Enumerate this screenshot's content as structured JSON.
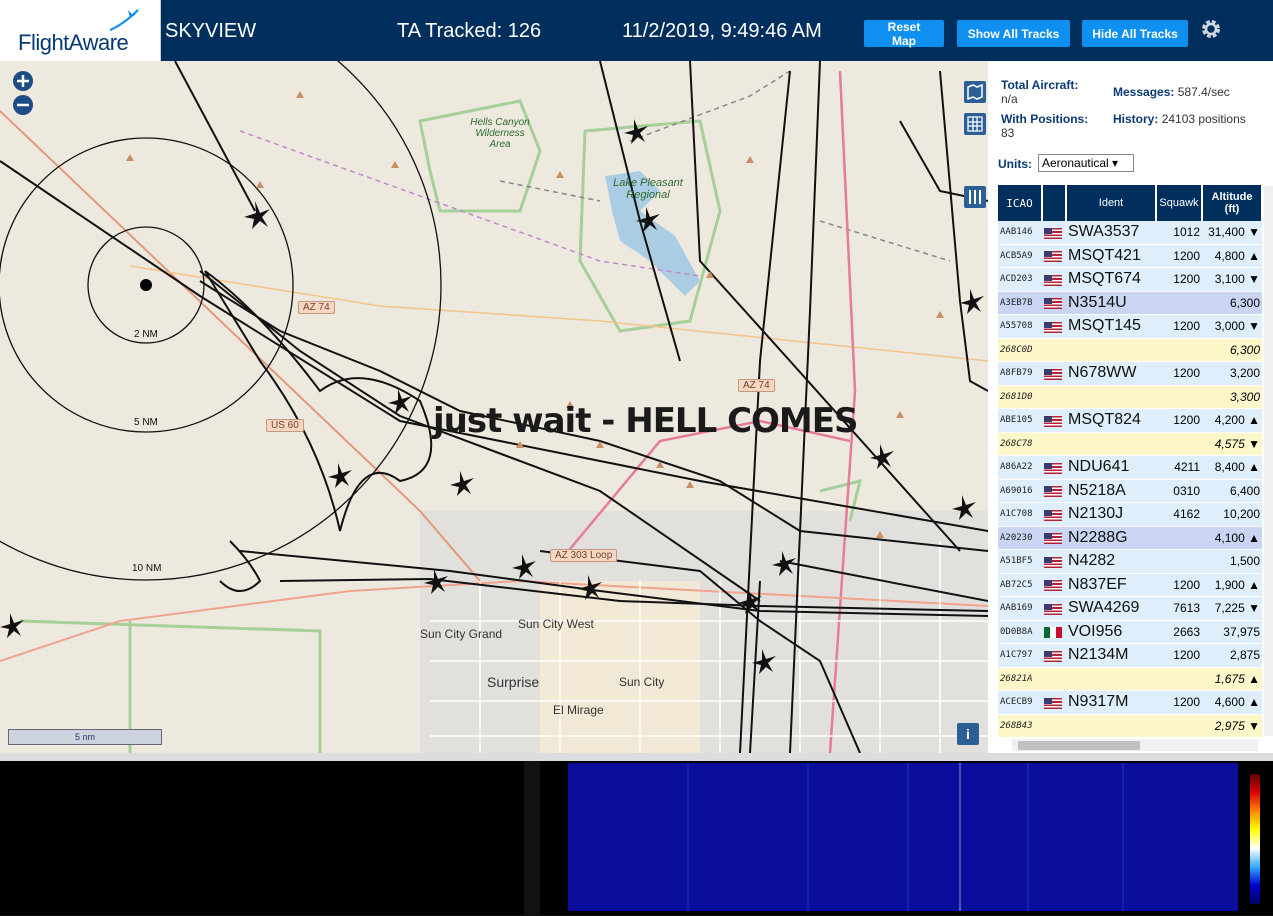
{
  "header": {
    "logo": "FlightAware",
    "site_name": "SKYVIEW",
    "ta_tracked": "TA Tracked: 126",
    "clock": "11/2/2019, 9:49:46 AM",
    "buttons": {
      "reset": "Reset Map",
      "show": "Show All Tracks",
      "hide": "Hide All Tracks"
    }
  },
  "map": {
    "overlay_text": "just wait - HELL COMES",
    "places": [
      "Hells Canyon Wilderness Area",
      "Lake Pleasant Regional",
      "Sun City Grand",
      "Sun City West",
      "Surprise",
      "Sun City",
      "El Mirage"
    ],
    "range_rings": [
      "2 NM",
      "5 NM",
      "10 NM"
    ],
    "road_tags": [
      "AZ 74",
      "AZ 74",
      "US 60",
      "AZ 303 Loop"
    ],
    "scale": "5 nm",
    "info": "i"
  },
  "sidebar": {
    "total_label": "Total Aircraft:",
    "total_value": "n/a",
    "messages_label": "Messages:",
    "messages_value": "587.4/sec",
    "positions_label": "With Positions:",
    "positions_value": "83",
    "history_label": "History:",
    "history_value": "24103 positions",
    "units_label": "Units:",
    "units_value": "Aeronautical",
    "columns": [
      "ICAO",
      "",
      "Ident",
      "Squawk",
      "Altitude (ft)"
    ],
    "rows": [
      {
        "icao": "AAB146",
        "flag": "us",
        "ident": "SWA3537",
        "squawk": "1012",
        "alt": "31,400 ▼",
        "style": "blue"
      },
      {
        "icao": "ACB5A9",
        "flag": "us",
        "ident": "MSQT421",
        "squawk": "1200",
        "alt": "4,800 ▲",
        "style": "blue"
      },
      {
        "icao": "ACD203",
        "flag": "us",
        "ident": "MSQT674",
        "squawk": "1200",
        "alt": "3,100 ▼",
        "style": "blue"
      },
      {
        "icao": "A3EB7B",
        "flag": "us",
        "ident": "N3514U",
        "squawk": "",
        "alt": "6,300",
        "style": "sel"
      },
      {
        "icao": "A55708",
        "flag": "us",
        "ident": "MSQT145",
        "squawk": "1200",
        "alt": "3,000 ▼",
        "style": "blue"
      },
      {
        "icao": "268C0D",
        "flag": "",
        "ident": "",
        "squawk": "",
        "alt": "6,300",
        "style": "yellow"
      },
      {
        "icao": "A8FB79",
        "flag": "us",
        "ident": "N678WW",
        "squawk": "1200",
        "alt": "3,200",
        "style": "blue"
      },
      {
        "icao": "2681D0",
        "flag": "",
        "ident": "",
        "squawk": "",
        "alt": "3,300",
        "style": "yellow"
      },
      {
        "icao": "ABE105",
        "flag": "us",
        "ident": "MSQT824",
        "squawk": "1200",
        "alt": "4,200 ▲",
        "style": "blue"
      },
      {
        "icao": "268C78",
        "flag": "",
        "ident": "",
        "squawk": "",
        "alt": "4,575 ▼",
        "style": "yellow"
      },
      {
        "icao": "A86A22",
        "flag": "us",
        "ident": "NDU641",
        "squawk": "4211",
        "alt": "8,400 ▲",
        "style": "blue"
      },
      {
        "icao": "A69016",
        "flag": "us",
        "ident": "N5218A",
        "squawk": "0310",
        "alt": "6,400",
        "style": "blue"
      },
      {
        "icao": "A1C708",
        "flag": "us",
        "ident": "N2130J",
        "squawk": "4162",
        "alt": "10,200",
        "style": "blue"
      },
      {
        "icao": "A20230",
        "flag": "us",
        "ident": "N2288G",
        "squawk": "",
        "alt": "4,100 ▲",
        "style": "sel"
      },
      {
        "icao": "A51BF5",
        "flag": "us",
        "ident": "N4282",
        "squawk": "",
        "alt": "1,500",
        "style": "blue"
      },
      {
        "icao": "AB72C5",
        "flag": "us",
        "ident": "N837EF",
        "squawk": "1200",
        "alt": "1,900 ▲",
        "style": "blue"
      },
      {
        "icao": "AAB169",
        "flag": "us",
        "ident": "SWA4269",
        "squawk": "7613",
        "alt": "7,225 ▼",
        "style": "blue"
      },
      {
        "icao": "0D0B8A",
        "flag": "mx",
        "ident": "VOI956",
        "squawk": "2663",
        "alt": "37,975",
        "style": "blue"
      },
      {
        "icao": "A1C797",
        "flag": "us",
        "ident": "N2134M",
        "squawk": "1200",
        "alt": "2,875",
        "style": "blue"
      },
      {
        "icao": "26821A",
        "flag": "",
        "ident": "",
        "squawk": "",
        "alt": "1,675 ▲",
        "style": "yellow"
      },
      {
        "icao": "ACECB9",
        "flag": "us",
        "ident": "N9317M",
        "squawk": "1200",
        "alt": "4,600 ▲",
        "style": "blue"
      },
      {
        "icao": "268B43",
        "flag": "",
        "ident": "",
        "squawk": "",
        "alt": "2,975 ▼",
        "style": "yellow"
      }
    ]
  },
  "colors": {
    "header": "#002f5d",
    "button": "#0f8ff0",
    "map_bg": "#ede9df"
  }
}
